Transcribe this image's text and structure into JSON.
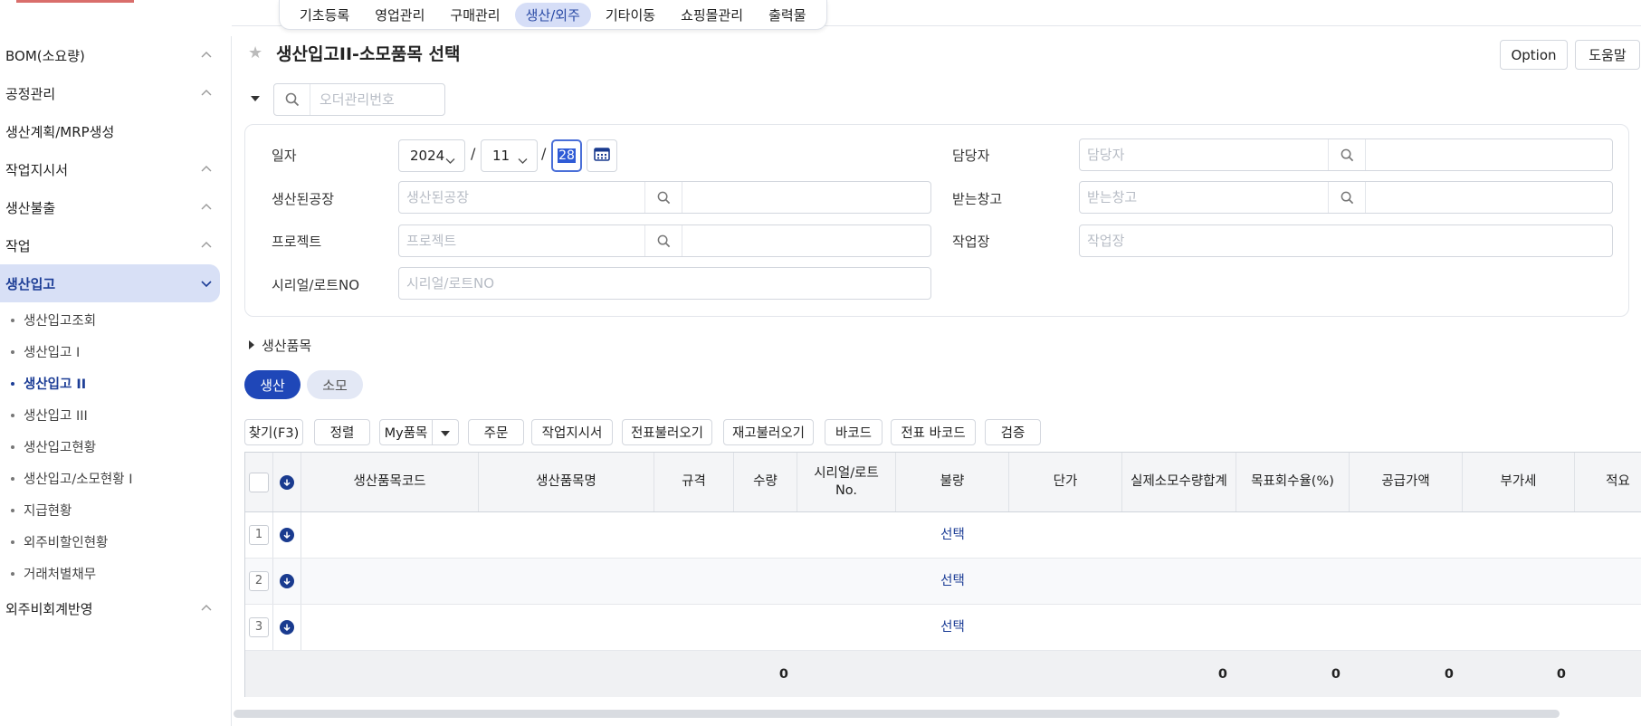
{
  "app": {
    "colors": {
      "accent": "#1f47b8",
      "accent_light": "#d8e0f6"
    }
  },
  "topnav": {
    "tabs": [
      {
        "label": "기초등록"
      },
      {
        "label": "영업관리"
      },
      {
        "label": "구매관리"
      },
      {
        "label": "생산/외주",
        "active": true
      },
      {
        "label": "기타이동"
      },
      {
        "label": "쇼핑몰관리"
      },
      {
        "label": "출력물"
      }
    ]
  },
  "sidebar": {
    "items": [
      {
        "label": "BOM(소요량)"
      },
      {
        "label": "공정관리"
      },
      {
        "label": "생산계획/MRP생성"
      },
      {
        "label": "작업지시서"
      },
      {
        "label": "생산불출"
      },
      {
        "label": "작업"
      },
      {
        "label": "생산입고"
      },
      {
        "label": "외주비회계반영"
      }
    ],
    "subitems": [
      {
        "label": "생산입고조회"
      },
      {
        "label": "생산입고 I"
      },
      {
        "label": "생산입고 II"
      },
      {
        "label": "생산입고 III"
      },
      {
        "label": "생산입고현황"
      },
      {
        "label": "생산입고/소모현황 I"
      },
      {
        "label": "지급현황"
      },
      {
        "label": "외주비할인현황"
      },
      {
        "label": "거래처별채무"
      }
    ]
  },
  "header": {
    "title": "생산입고II-소모품목 선택",
    "option_label": "Option",
    "help_label": "도움말"
  },
  "search": {
    "placeholder": "오더관리번호"
  },
  "filters": {
    "date_label": "일자",
    "year": "2024",
    "month": "11",
    "day": "28",
    "sep": "/",
    "factory_label": "생산된공장",
    "factory_placeholder": "생산된공장",
    "project_label": "프로젝트",
    "project_placeholder": "프로젝트",
    "serial_label": "시리얼/로트NO",
    "serial_placeholder": "시리얼/로트NO",
    "manager_label": "담당자",
    "manager_placeholder": "담당자",
    "warehouse_label": "받는창고",
    "warehouse_placeholder": "받는창고",
    "workplace_label": "작업장",
    "workplace_placeholder": "작업장"
  },
  "section": {
    "title": "생산품목",
    "pills": [
      {
        "label": "생산"
      },
      {
        "label": "소모"
      }
    ]
  },
  "toolbar": {
    "find": "찾기(F3)",
    "sort": "정렬",
    "myitem": "My품목",
    "order": "주문",
    "workorder": "작업지시서",
    "load_slip": "전표불러오기",
    "load_stock": "재고불러오기",
    "barcode": "바코드",
    "slip_barcode": "전표 바코드",
    "verify": "검증"
  },
  "grid": {
    "columns": [
      "생산품목코드",
      "생산품목명",
      "규격",
      "수량",
      "시리얼/로트 No.",
      "불량",
      "단가",
      "실제소모수량합계",
      "목표회수율(%)",
      "공급가액",
      "부가세",
      "적요"
    ],
    "rows": [
      {
        "num": "1",
        "defect": "선택"
      },
      {
        "num": "2",
        "defect": "선택"
      },
      {
        "num": "3",
        "defect": "선택"
      }
    ],
    "totals": {
      "qty": "0",
      "consumed": "0",
      "target": "0",
      "supply": "0",
      "vat": "0"
    }
  }
}
